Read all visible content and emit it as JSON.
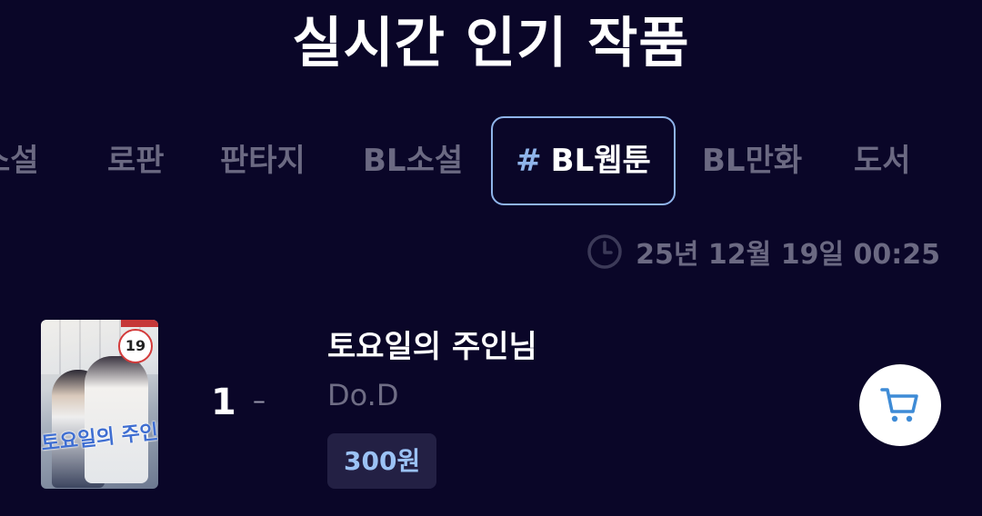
{
  "page": {
    "title": "실시간 인기 작품"
  },
  "tabs": [
    {
      "label": "소설"
    },
    {
      "label": "로판"
    },
    {
      "label": "판타지"
    },
    {
      "label": "BL소설"
    },
    {
      "label": "BL웹툰",
      "prefix": "#",
      "active": true
    },
    {
      "label": "BL만화"
    },
    {
      "label": "도서"
    }
  ],
  "updated": {
    "icon": "clock-icon",
    "timestamp": "25년 12월 19일 00:25"
  },
  "ranking": [
    {
      "rank": "1",
      "change": "–",
      "title": "토요일의 주인님",
      "author": "Do.D",
      "price": "300원",
      "age_badge": "19",
      "cover_title": "토요일의 주인님",
      "cart_icon": "cart-icon"
    }
  ],
  "colors": {
    "background": "#0a0628",
    "active_tab_border": "#8fb4ea",
    "inactive_text": "#6b6982",
    "price_text": "#9bc2f5",
    "price_bg": "#232044",
    "cart_icon": "#3e8bd6"
  }
}
